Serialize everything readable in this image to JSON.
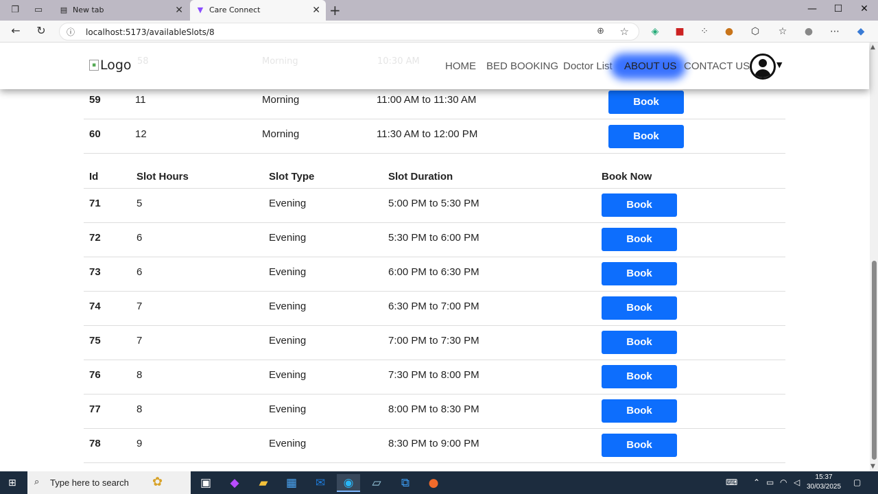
{
  "browser": {
    "tabs": [
      {
        "title": "New tab",
        "active": false
      },
      {
        "title": "Care Connect",
        "active": true
      }
    ],
    "url": "localhost:5173/availableSlots/8"
  },
  "site": {
    "logo_alt": "Logo",
    "nav": [
      "HOME",
      "BED BOOKING",
      "Doctor List",
      "ABOUT US",
      "CONTACT US"
    ]
  },
  "morning_rows": [
    {
      "id": "59",
      "hours": "11",
      "type": "Morning",
      "duration": "11:00 AM to 11:30 AM",
      "button": "Book"
    },
    {
      "id": "60",
      "hours": "12",
      "type": "Morning",
      "duration": "11:30 AM to 12:00 PM",
      "button": "Book"
    }
  ],
  "evening_table": {
    "headers": [
      "Id",
      "Slot Hours",
      "Slot Type",
      "Slot Duration",
      "Book Now"
    ],
    "rows": [
      {
        "id": "71",
        "hours": "5",
        "type": "Evening",
        "duration": "5:00 PM to 5:30 PM",
        "button": "Book"
      },
      {
        "id": "72",
        "hours": "6",
        "type": "Evening",
        "duration": "5:30 PM to 6:00 PM",
        "button": "Book"
      },
      {
        "id": "73",
        "hours": "6",
        "type": "Evening",
        "duration": "6:00 PM to 6:30 PM",
        "button": "Book"
      },
      {
        "id": "74",
        "hours": "7",
        "type": "Evening",
        "duration": "6:30 PM to 7:00 PM",
        "button": "Book"
      },
      {
        "id": "75",
        "hours": "7",
        "type": "Evening",
        "duration": "7:00 PM to 7:30 PM",
        "button": "Book"
      },
      {
        "id": "76",
        "hours": "8",
        "type": "Evening",
        "duration": "7:30 PM to 8:00 PM",
        "button": "Book"
      },
      {
        "id": "77",
        "hours": "8",
        "type": "Evening",
        "duration": "8:00 PM to 8:30 PM",
        "button": "Book"
      },
      {
        "id": "78",
        "hours": "9",
        "type": "Evening",
        "duration": "8:30 PM to 9:00 PM",
        "button": "Book"
      }
    ]
  },
  "taskbar": {
    "search_placeholder": "Type here to search",
    "time": "15:37",
    "date": "30/03/2025"
  },
  "colors": {
    "book_button": "#0d6efd",
    "taskbar": "#1c2c3e"
  }
}
